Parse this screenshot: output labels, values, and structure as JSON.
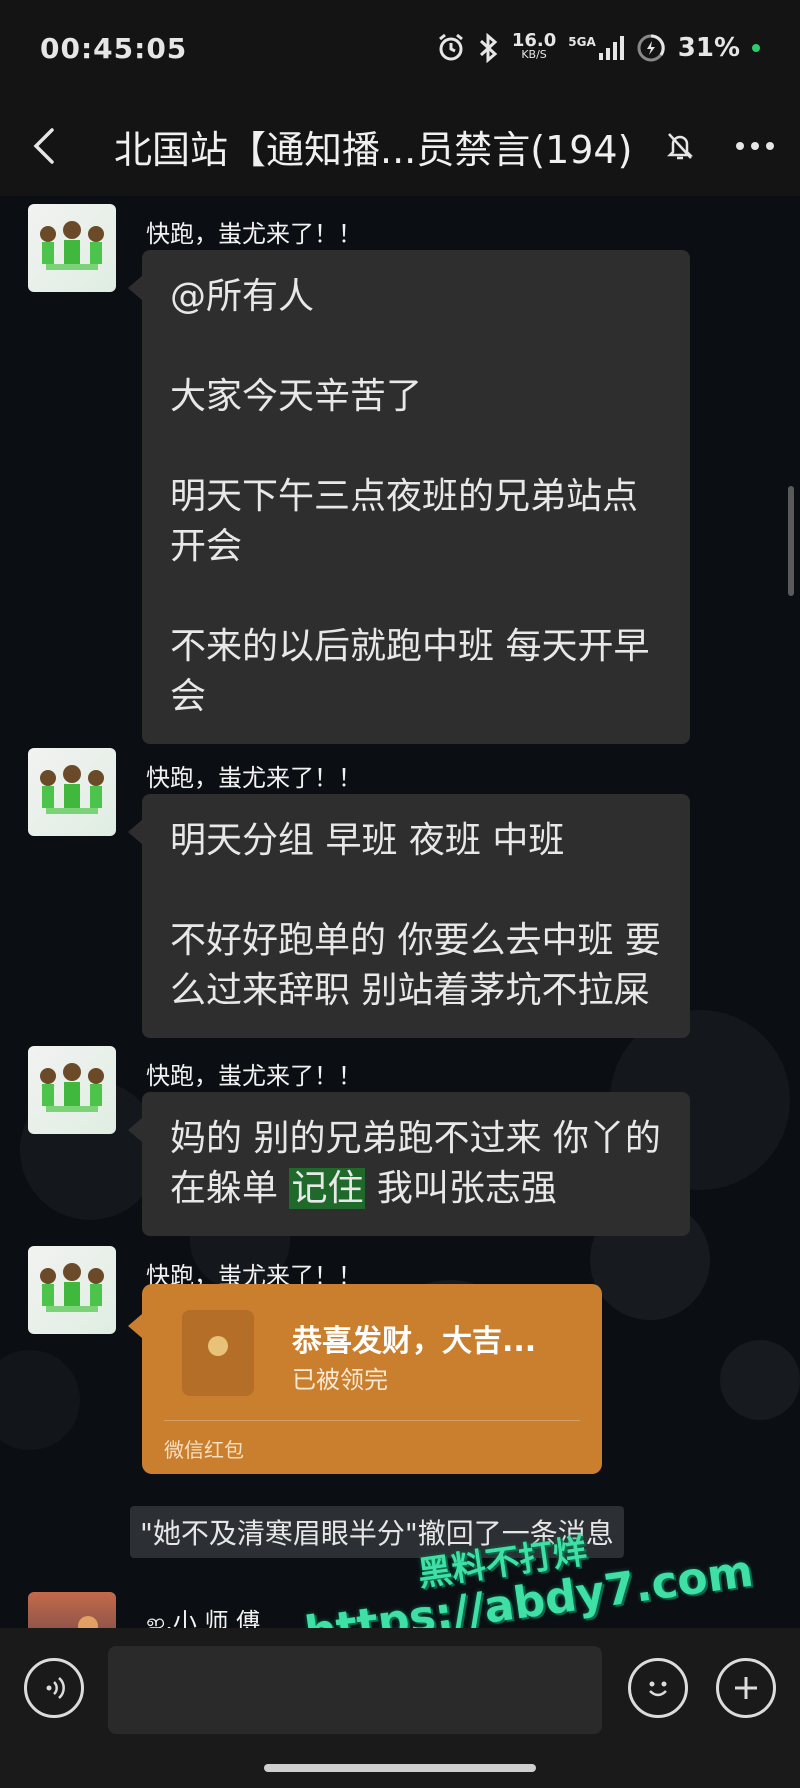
{
  "status_bar": {
    "time": "00:45:05",
    "net_speed": "16.0",
    "net_unit": "KB/S",
    "network": "5GA",
    "battery": "31%",
    "colors": {
      "battery_dot": "#2ecc71"
    }
  },
  "nav": {
    "title": "北国站【通知播...员禁言(194)"
  },
  "messages": [
    {
      "sender": "快跑，蚩尤来了！！",
      "lines": [
        "@所有人",
        "大家今天辛苦了",
        "明天下午三点夜班的兄弟站点开会",
        "不来的以后就跑中班 每天开早会"
      ]
    },
    {
      "sender": "快跑，蚩尤来了！！",
      "lines": [
        "明天分组 早班 夜班 中班",
        "不好好跑单的 你要么去中班 要么过来辞职 别站着茅坑不拉屎"
      ]
    },
    {
      "sender": "快跑，蚩尤来了！！",
      "parts": [
        "妈的 别的兄弟跑不过来  你丫的在躲单 ",
        "记住",
        " 我叫张志强"
      ]
    },
    {
      "sender": "快跑，蚩尤来了！！",
      "red_packet": {
        "title": "恭喜发财，大吉...",
        "status": "已被领完",
        "footer": "微信红包"
      }
    }
  ],
  "recall_notice": "\"她不及清寒眉眼半分\"撤回了一条消息",
  "last_sender": "ஐ.小 师 傅",
  "watermark": {
    "line1": "黑料不打烊",
    "line2": "https://abdy7.com"
  },
  "input": {
    "placeholder": ""
  }
}
